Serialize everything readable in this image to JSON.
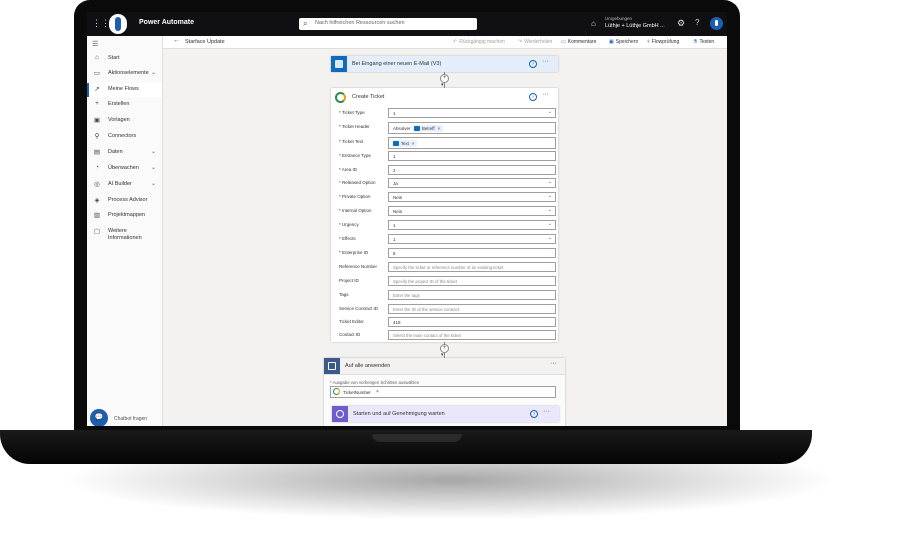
{
  "app": {
    "title": "Power Automate",
    "search_placeholder": "Nach hilfreichen Ressourcen suchen",
    "env_label": "Umgebungen",
    "env_value": "Lüthje + Lüthje GmbH ..."
  },
  "sidebar": {
    "items": [
      {
        "label": "Start",
        "icon": "⌂"
      },
      {
        "label": "Aktionselemente",
        "icon": "▭",
        "chevron": true
      },
      {
        "label": "Meine Flows",
        "icon": "↗"
      },
      {
        "label": "Erstellen",
        "icon": "+"
      },
      {
        "label": "Vorlagen",
        "icon": "▣"
      },
      {
        "label": "Connectors",
        "icon": "⚲"
      },
      {
        "label": "Daten",
        "icon": "▤",
        "chevron": true
      },
      {
        "label": "Überwachen",
        "icon": "◔",
        "chevron": true
      },
      {
        "label": "AI Builder",
        "icon": "◎",
        "chevron": true
      },
      {
        "label": "Process Advisor",
        "icon": "◈"
      },
      {
        "label": "Projektmappen",
        "icon": "▥"
      },
      {
        "label": "Weitere Informationen",
        "icon": "▢"
      }
    ],
    "chatbot_label": "Chatbot fragen"
  },
  "commandbar": {
    "flow_name": "Starface Update",
    "undo": "Rückgängig machen",
    "redo": "Wiederholen",
    "comments": "Kommentare",
    "save": "Speichern",
    "checker": "Flowprüfung",
    "test": "Testen"
  },
  "trigger": {
    "title": "Bei Eingang einer neuen E-Mail (V3)"
  },
  "create_ticket": {
    "title": "Create Ticket",
    "fields": [
      {
        "label": "* Ticket Type",
        "value": "1",
        "dropdown": true
      },
      {
        "label": "* Ticket Header",
        "prefix": "Absolver",
        "token": "Betreff"
      },
      {
        "label": "* Ticket Text",
        "token": "Text"
      },
      {
        "label": "* Entrance Type",
        "value": "1"
      },
      {
        "label": "* Area ID",
        "value": "2"
      },
      {
        "label": "* Released Option",
        "value": "Ja",
        "dropdown": true
      },
      {
        "label": "* Private Option",
        "value": "Nein",
        "dropdown": true
      },
      {
        "label": "* Internal Option",
        "value": "Nein",
        "dropdown": true
      },
      {
        "label": "* Urgency",
        "value": "1",
        "dropdown": true
      },
      {
        "label": "* Effects",
        "value": "1",
        "dropdown": true
      },
      {
        "label": "* Enterprise ID",
        "value": "5"
      },
      {
        "label": "Reference Number",
        "placeholder": "Specify the ticket or reference number of an existing ticket"
      },
      {
        "label": "Project ID",
        "placeholder": "Specify the project ID of the ticket"
      },
      {
        "label": "Tags",
        "placeholder": "Enter the tags"
      },
      {
        "label": "Service Contract ID",
        "placeholder": "Enter the ID of the service contract"
      },
      {
        "label": "Ticket Editor",
        "value": "418"
      },
      {
        "label": "Contact ID",
        "placeholder": "Select the main contact of the ticket"
      }
    ]
  },
  "apply_to_each": {
    "title": "Auf alle anwenden",
    "select_label": "* Ausgabe von vorherigen Schritten auswählen",
    "token": "TicketNumber"
  },
  "approval": {
    "title": "Starten und auf Genehmigung warten"
  },
  "colors": {
    "brand": "#1b5fae",
    "outlook": "#0f6cbd",
    "loop": "#3a5a8c",
    "approval": "#6d5bd0"
  }
}
